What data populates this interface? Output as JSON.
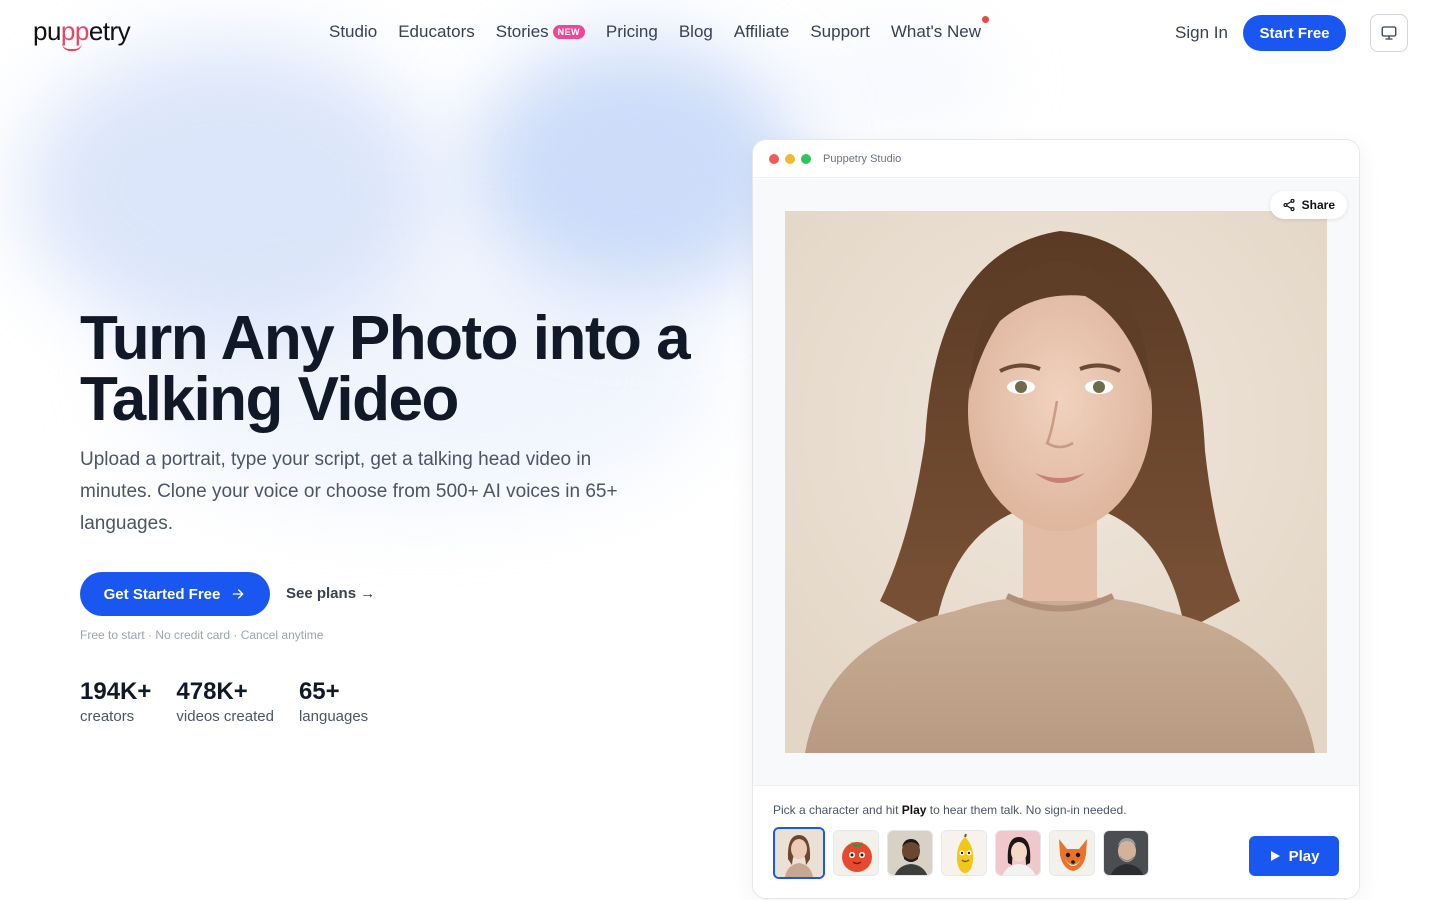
{
  "nav": {
    "logo_pre": "pu",
    "logo_mid": "pp",
    "logo_post": "etry",
    "links": [
      {
        "label": "Studio"
      },
      {
        "label": "Educators"
      },
      {
        "label": "Stories",
        "badge": "NEW"
      },
      {
        "label": "Pricing"
      },
      {
        "label": "Blog"
      },
      {
        "label": "Affiliate"
      },
      {
        "label": "Support"
      },
      {
        "label": "What's New"
      }
    ],
    "sign_in": "Sign In",
    "start_free": "Start Free",
    "monitor_icon": "monitor-icon"
  },
  "hero": {
    "title_line1": "Turn Any Photo into a",
    "title_line2": "Talking Video",
    "subtitle": "Upload a portrait, type your script, get a talking head video in minutes. Clone your voice or choose from 500+ AI voices in 65+ languages.",
    "cta_primary": "Get Started Free",
    "cta_secondary": "See plans →",
    "fineprint": "Free to start · No credit card · Cancel anytime",
    "stats": [
      {
        "value": "194K+",
        "label": "creators"
      },
      {
        "value": "478K+",
        "label": "videos created"
      },
      {
        "value": "65+",
        "label": "languages"
      }
    ]
  },
  "studio": {
    "window_title": "Puppetry Studio",
    "share_label": "Share",
    "hint_pre": "Pick a character and hit ",
    "hint_bold": "Play",
    "hint_post": " to hear them talk. No sign-in needed.",
    "play_label": "Play",
    "characters": [
      "woman-portrait",
      "tomato-character",
      "man-portrait",
      "banana-character",
      "asian-woman-portrait",
      "fox-character",
      "older-man-portrait"
    ]
  },
  "colors": {
    "accent": "#1a56f0",
    "logo_accent": "#ef4461",
    "badge": "#ec4899"
  }
}
